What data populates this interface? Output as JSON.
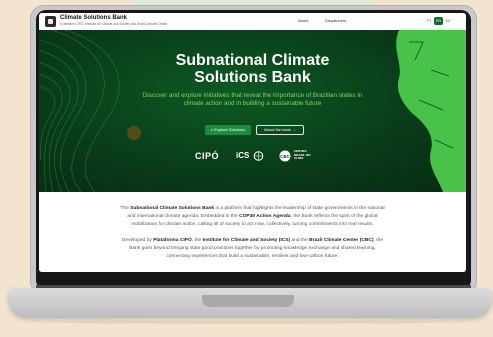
{
  "nav": {
    "brand_title": "Climate Solutions Bank",
    "brand_subtitle": "A Initiative CIPÓ, Institute for Climate and Society and Brazil Climate Center",
    "links": [
      "About",
      "Dispatchers"
    ],
    "languages": [
      "PT",
      "EN",
      "ES"
    ],
    "active_language": "EN"
  },
  "hero": {
    "title_line1": "Subnational Climate",
    "title_line2": "Solutions Bank",
    "subtitle": "Discover and explore initiatives that reveal the importance of Brazilian states in climate action and in building a sustainable future",
    "primary_button": "Explore Solutions",
    "secondary_button": "About the bank",
    "partners": {
      "cipo": "CIPÓ",
      "ics": "iCS",
      "csc": "CENTRO BRASIL NO CLIMA"
    }
  },
  "about": {
    "p1": {
      "a": "The ",
      "b": "Subnational Climate Solutions Bank",
      "c": " is a platform that highlights the leadership of state governments in the national and international climate agenda. Embedded in the ",
      "d": "COP30 Action Agenda",
      "e": ", the Bank reflects the spirit of the global mobilization for climate action, calling all of society to act now, collectively, turning commitments into real results."
    },
    "p2": {
      "a": "Developed by ",
      "b": "Plataforma CIPÓ",
      "c": ", the ",
      "d": "Institute for Climate and Society (ICS)",
      "e": " and the ",
      "f": "Brazil Climate Center (CBC)",
      "g": ", the Bank goes beyond bringing state good practices together by promoting knowledge exchange and shared learning, connecting experiences that build a sustainable, resilient and low-carbon future."
    }
  },
  "colors": {
    "hero_bg": "#093d19",
    "accent_green": "#1c8d3c",
    "subtitle_green": "#7fd36a",
    "background": "#f3e4cf"
  }
}
